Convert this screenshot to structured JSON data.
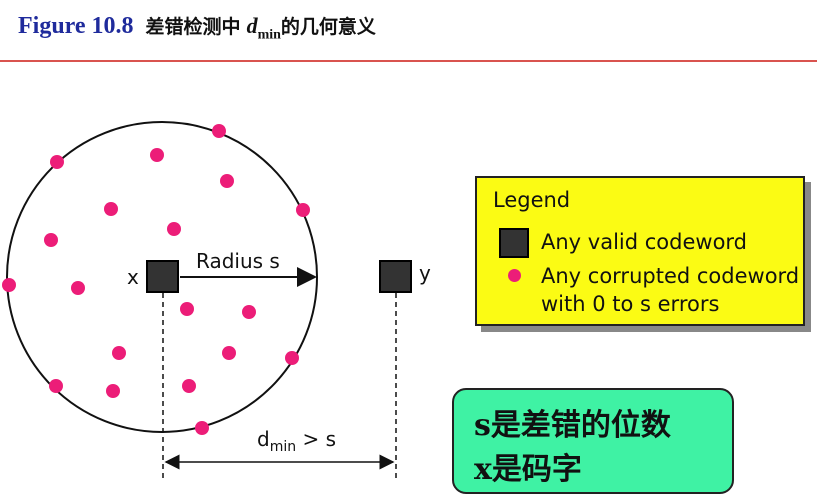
{
  "header": {
    "figure_label": "Figure 10.8",
    "caption_prefix": "差错检测中",
    "dmin_d": "d",
    "dmin_sub": "min",
    "caption_suffix": "的几何意义"
  },
  "diagram": {
    "radius_label": "Radius s",
    "x_label": "x",
    "y_label": "y",
    "distance_label_main": "d",
    "distance_label_sub": "min",
    "distance_label_rest": " > s"
  },
  "legend": {
    "title": "Legend",
    "valid_label": "Any valid codeword",
    "corrupted_line1": "Any corrupted codeword",
    "corrupted_line2": "with 0 to s errors"
  },
  "note": {
    "line1": "s是差错的位数",
    "line2": "x是码字"
  },
  "colors": {
    "title_blue": "#1f2b9c",
    "rule_red": "#d9534f",
    "dot_pink": "#ec1d78",
    "legend_yellow": "#fbfb14",
    "note_green": "#3ff2a4"
  }
}
